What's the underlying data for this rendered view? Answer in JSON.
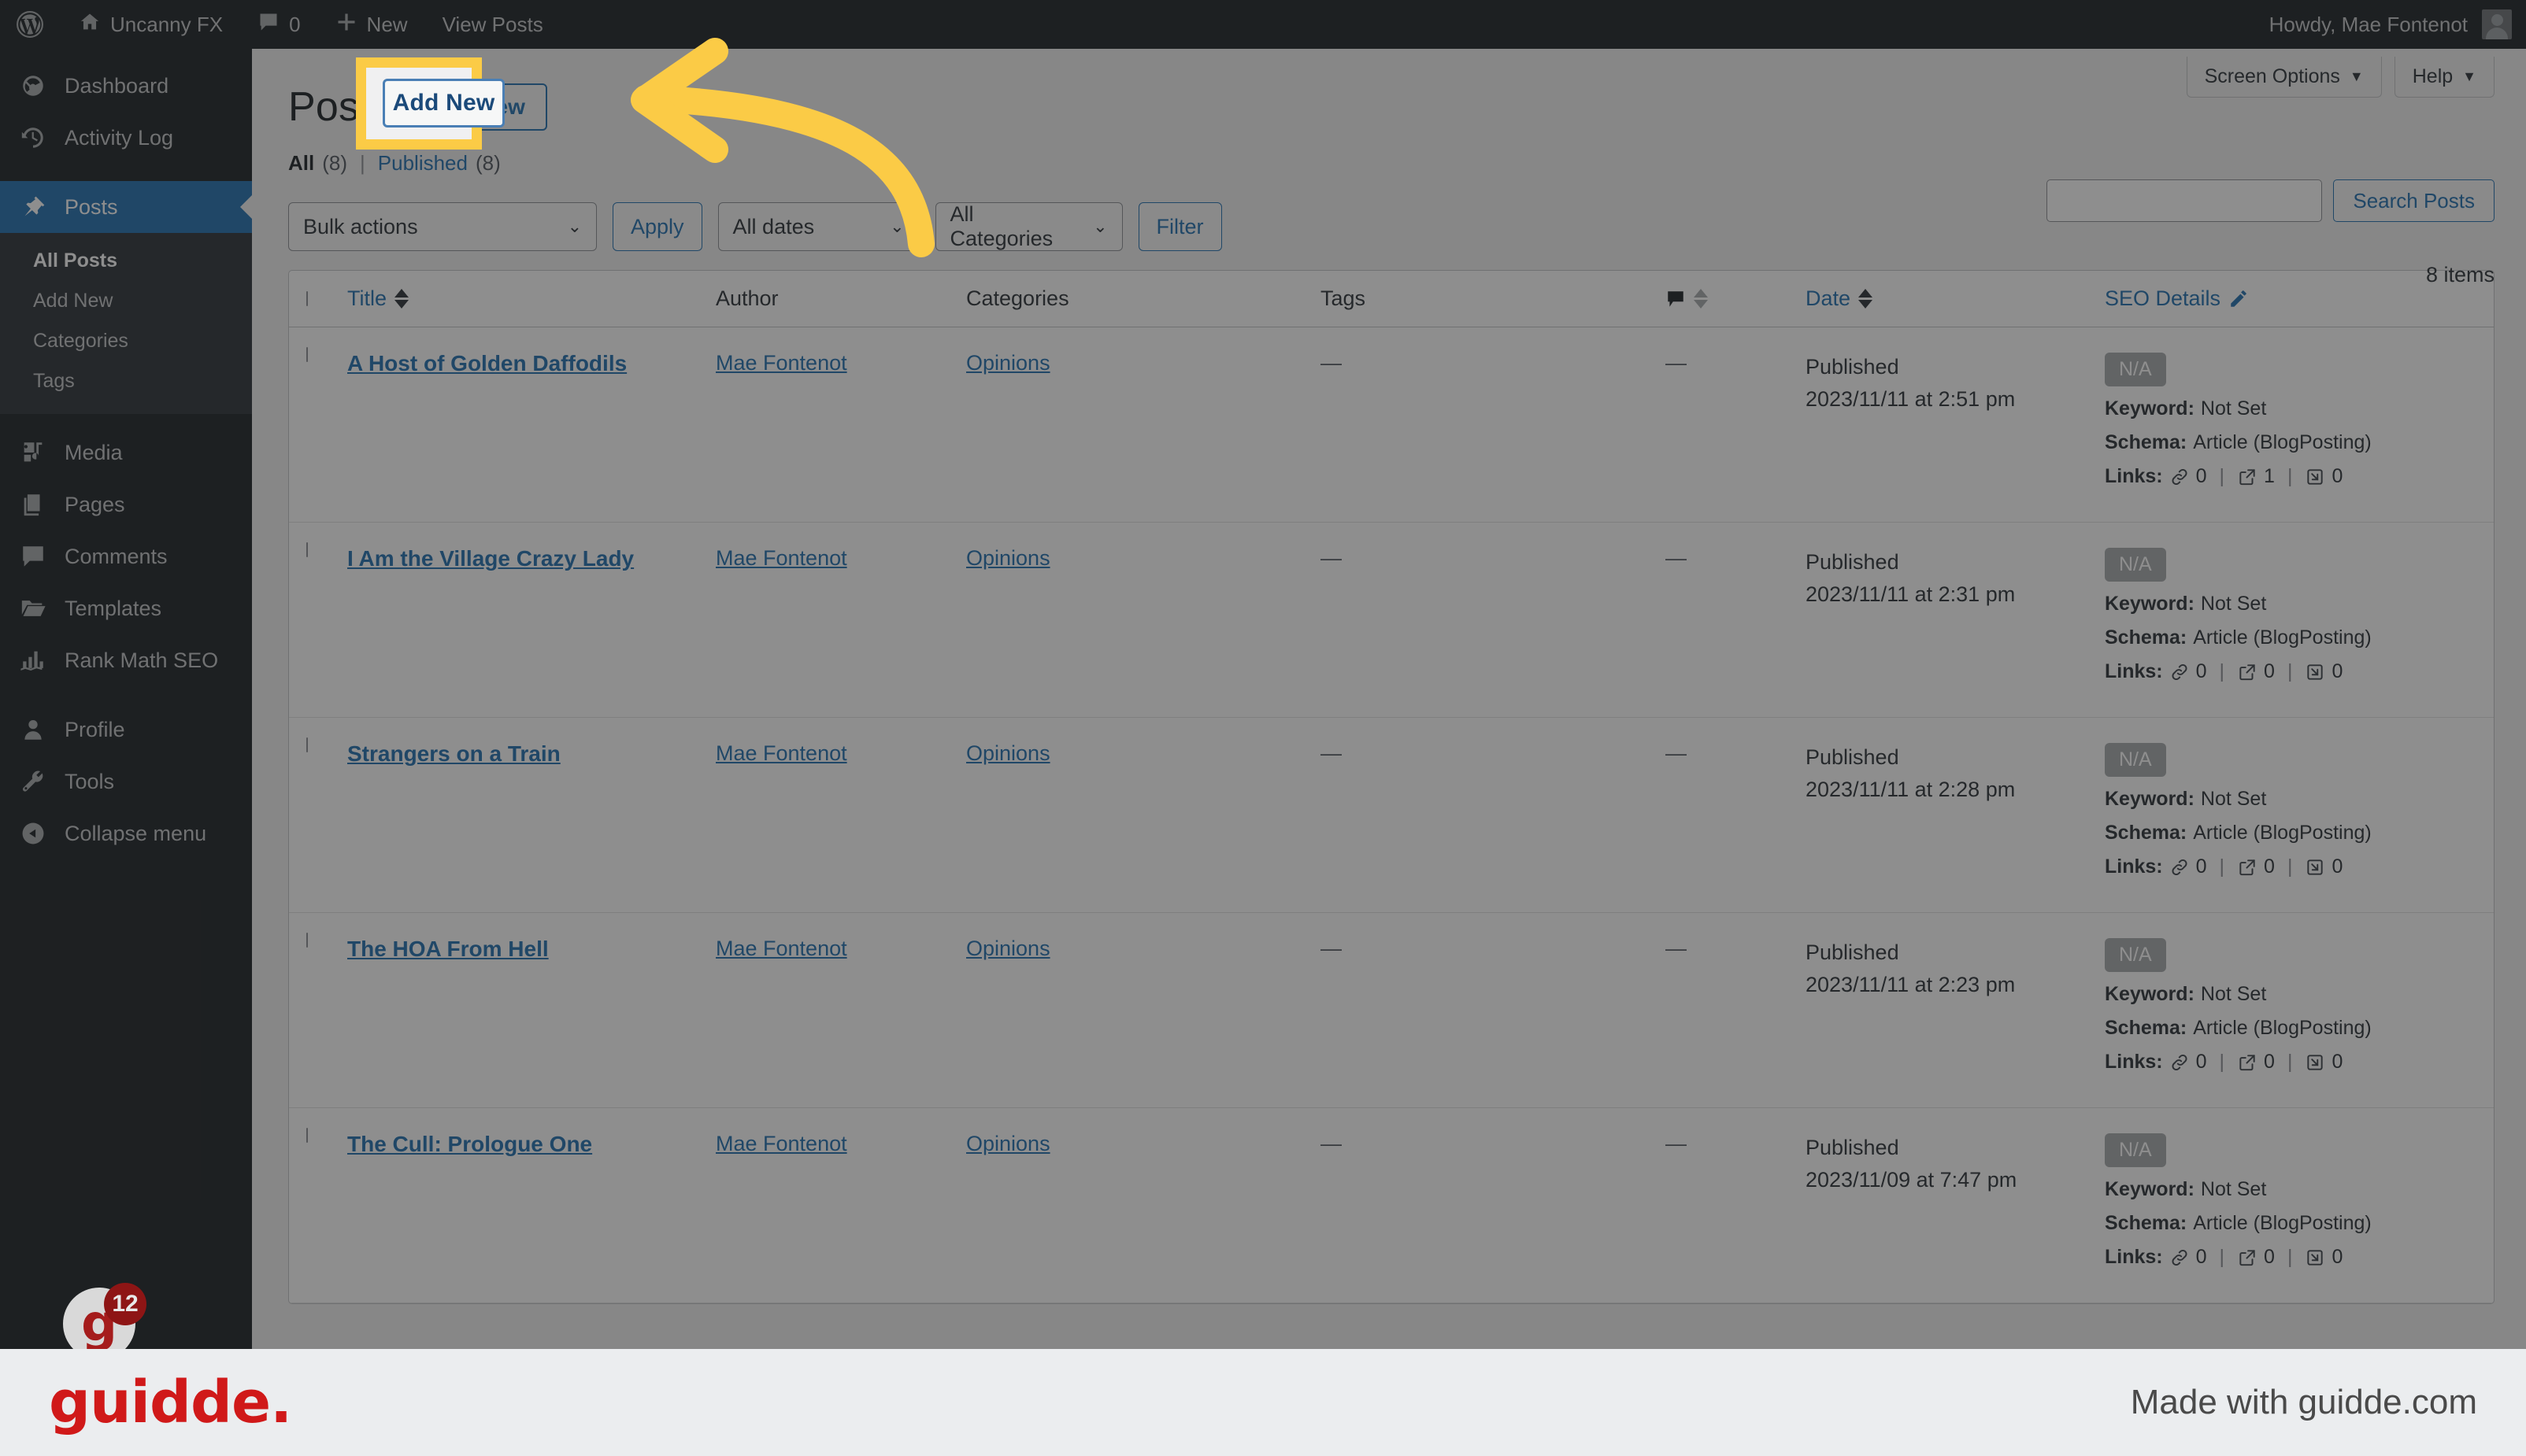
{
  "adminbar": {
    "logo_icon": "wordpress-icon",
    "home_icon": "home-icon",
    "site_name": "Uncanny FX",
    "comments_icon": "comment-bubble-icon",
    "comments_count": "0",
    "new_icon": "plus-icon",
    "new_label": "New",
    "view_posts_label": "View Posts",
    "howdy": "Howdy, Mae Fontenot",
    "avatar_icon": "avatar-icon"
  },
  "sidebar": {
    "items": [
      {
        "label": "Dashboard",
        "icon": "dashboard-icon",
        "active": false
      },
      {
        "label": "Activity Log",
        "icon": "clock-history-icon",
        "active": false
      },
      {
        "label": "Posts",
        "icon": "pin-icon",
        "active": true
      },
      {
        "label": "Media",
        "icon": "media-icon",
        "active": false
      },
      {
        "label": "Pages",
        "icon": "pages-icon",
        "active": false
      },
      {
        "label": "Comments",
        "icon": "comment-icon",
        "active": false
      },
      {
        "label": "Templates",
        "icon": "folder-icon",
        "active": false
      },
      {
        "label": "Rank Math SEO",
        "icon": "bar-chart-icon",
        "active": false
      },
      {
        "label": "Profile",
        "icon": "user-icon",
        "active": false
      },
      {
        "label": "Tools",
        "icon": "wrench-icon",
        "active": false
      },
      {
        "label": "Collapse menu",
        "icon": "collapse-arrow-icon",
        "active": false
      }
    ],
    "submenu": [
      {
        "label": "All Posts",
        "current": true
      },
      {
        "label": "Add New",
        "current": false
      },
      {
        "label": "Categories",
        "current": false
      },
      {
        "label": "Tags",
        "current": false
      }
    ]
  },
  "screen_meta": {
    "screen_options_label": "Screen Options",
    "help_label": "Help",
    "caret_icon": "chevron-down-icon"
  },
  "page": {
    "title": "Posts",
    "add_new_label": "Add New",
    "status_links": {
      "all_label": "All",
      "all_count": "(8)",
      "separator": "|",
      "published_label": "Published",
      "published_count": "(8)"
    },
    "items_count": "8 items"
  },
  "search": {
    "value": "",
    "placeholder": "",
    "button_label": "Search Posts",
    "input_name": "search-input"
  },
  "tablenav": {
    "bulk_actions": "Bulk actions",
    "apply_label": "Apply",
    "all_dates": "All dates",
    "all_categories": "All Categories",
    "filter_label": "Filter",
    "chevron_icon": "chevron-down-icon"
  },
  "table": {
    "headers": {
      "checkbox": "select-all-checkbox",
      "title": "Title",
      "author": "Author",
      "categories": "Categories",
      "tags": "Tags",
      "comments_icon": "comment-bubble-icon",
      "date": "Date",
      "seo_details": "SEO Details",
      "seo_edit_icon": "pencil-icon"
    },
    "rows": [
      {
        "title": "A Host of Golden Daffodils",
        "author": "Mae Fontenot",
        "categories": "Opinions",
        "tags": "—",
        "comments": "—",
        "date_status": "Published",
        "date_value": "2023/11/11 at 2:51 pm",
        "seo_score": "N/A",
        "keyword_label": "Keyword:",
        "keyword_value": "Not Set",
        "schema_label": "Schema:",
        "schema_value": "Article (BlogPosting)",
        "links_label": "Links:",
        "links_internal": "0",
        "links_external": "1",
        "links_incoming": "0"
      },
      {
        "title": "I Am the Village Crazy Lady",
        "author": "Mae Fontenot",
        "categories": "Opinions",
        "tags": "—",
        "comments": "—",
        "date_status": "Published",
        "date_value": "2023/11/11 at 2:31 pm",
        "seo_score": "N/A",
        "keyword_label": "Keyword:",
        "keyword_value": "Not Set",
        "schema_label": "Schema:",
        "schema_value": "Article (BlogPosting)",
        "links_label": "Links:",
        "links_internal": "0",
        "links_external": "0",
        "links_incoming": "0"
      },
      {
        "title": "Strangers on a Train",
        "author": "Mae Fontenot",
        "categories": "Opinions",
        "tags": "—",
        "comments": "—",
        "date_status": "Published",
        "date_value": "2023/11/11 at 2:28 pm",
        "seo_score": "N/A",
        "keyword_label": "Keyword:",
        "keyword_value": "Not Set",
        "schema_label": "Schema:",
        "schema_value": "Article (BlogPosting)",
        "links_label": "Links:",
        "links_internal": "0",
        "links_external": "0",
        "links_incoming": "0"
      },
      {
        "title": "The HOA From Hell",
        "author": "Mae Fontenot",
        "categories": "Opinions",
        "tags": "—",
        "comments": "—",
        "date_status": "Published",
        "date_value": "2023/11/11 at 2:23 pm",
        "seo_score": "N/A",
        "keyword_label": "Keyword:",
        "keyword_value": "Not Set",
        "schema_label": "Schema:",
        "schema_value": "Article (BlogPosting)",
        "links_label": "Links:",
        "links_internal": "0",
        "links_external": "0",
        "links_incoming": "0"
      },
      {
        "title": "The Cull: Prologue One",
        "author": "Mae Fontenot",
        "categories": "Opinions",
        "tags": "—",
        "comments": "—",
        "date_status": "Published",
        "date_value": "2023/11/09 at 7:47 pm",
        "seo_score": "N/A",
        "keyword_label": "Keyword:",
        "keyword_value": "Not Set",
        "schema_label": "Schema:",
        "schema_value": "Article (BlogPosting)",
        "links_label": "Links:",
        "links_internal": "0",
        "links_external": "0",
        "links_incoming": "0"
      }
    ]
  },
  "highlight": {
    "target_label": "Add New",
    "box_color": "#FBCB46",
    "arrow_icon": "curved-arrow-left-icon"
  },
  "guidde": {
    "badge_letter": "g",
    "badge_count": "12",
    "logo_text": "guidde.",
    "made_with": "Made with guidde.com"
  }
}
